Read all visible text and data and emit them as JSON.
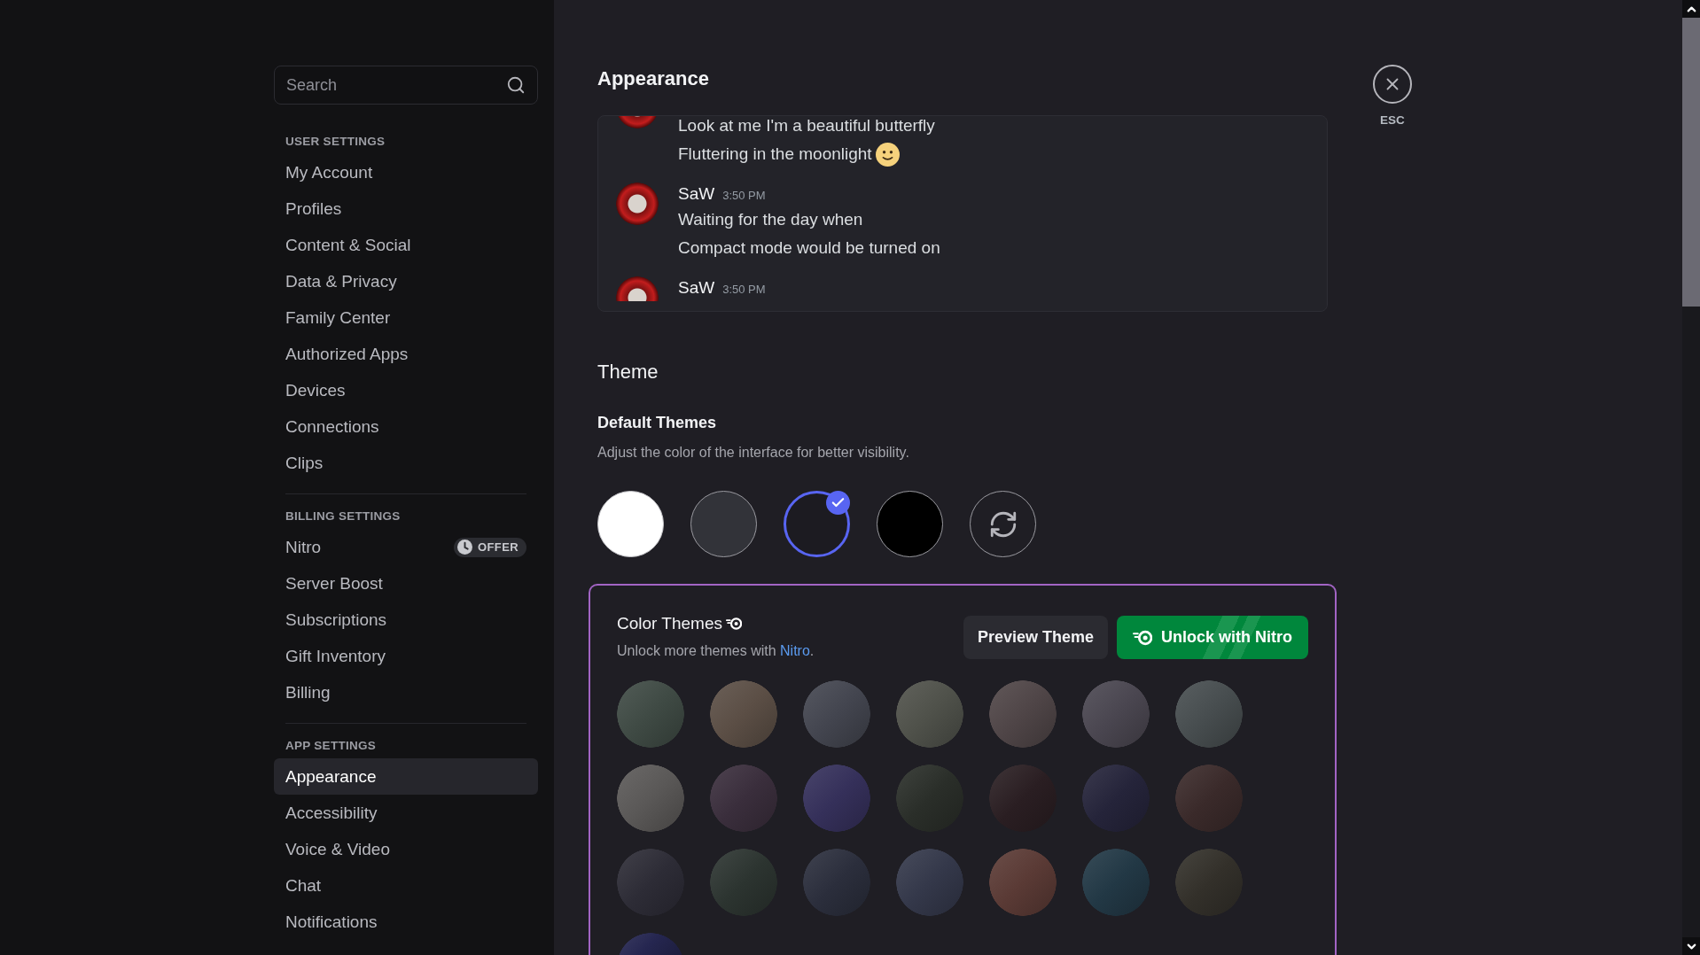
{
  "sidebar": {
    "search": {
      "placeholder": "Search"
    },
    "sections": [
      {
        "title": "USER SETTINGS",
        "items": [
          {
            "label": "My Account",
            "selected": false
          },
          {
            "label": "Profiles",
            "selected": false
          },
          {
            "label": "Content & Social",
            "selected": false
          },
          {
            "label": "Data & Privacy",
            "selected": false
          },
          {
            "label": "Family Center",
            "selected": false
          },
          {
            "label": "Authorized Apps",
            "selected": false
          },
          {
            "label": "Devices",
            "selected": false
          },
          {
            "label": "Connections",
            "selected": false
          },
          {
            "label": "Clips",
            "selected": false
          }
        ]
      },
      {
        "title": "BILLING SETTINGS",
        "items": [
          {
            "label": "Nitro",
            "selected": false,
            "badge": "OFFER"
          },
          {
            "label": "Server Boost",
            "selected": false
          },
          {
            "label": "Subscriptions",
            "selected": false
          },
          {
            "label": "Gift Inventory",
            "selected": false
          },
          {
            "label": "Billing",
            "selected": false
          }
        ]
      },
      {
        "title": "APP SETTINGS",
        "items": [
          {
            "label": "Appearance",
            "selected": true
          },
          {
            "label": "Accessibility",
            "selected": false
          },
          {
            "label": "Voice & Video",
            "selected": false
          },
          {
            "label": "Chat",
            "selected": false
          },
          {
            "label": "Notifications",
            "selected": false
          }
        ]
      }
    ]
  },
  "page": {
    "title": "Appearance",
    "close_label": "ESC"
  },
  "preview": {
    "messages": [
      {
        "lines": [
          {
            "text": "Look at me I'm a beautiful butterfly",
            "emoji": false
          },
          {
            "text": "Fluttering in the moonlight",
            "emoji": true
          }
        ]
      },
      {
        "author": "SaW",
        "time": "3:50 PM",
        "lines": [
          {
            "text": "Waiting for the day when",
            "emoji": false
          },
          {
            "text": "Compact mode would be turned on",
            "emoji": false
          }
        ]
      },
      {
        "author": "SaW",
        "time": "3:50 PM"
      }
    ]
  },
  "theme": {
    "title": "Theme",
    "default_themes": {
      "title": "Default Themes",
      "description": "Adjust the color of the interface for better visibility.",
      "options": [
        {
          "kind": "swatch",
          "color": "#ffffff",
          "selected": false
        },
        {
          "kind": "swatch",
          "color": "#323339",
          "selected": false
        },
        {
          "kind": "swatch",
          "color": "#1c1b21",
          "selected": true
        },
        {
          "kind": "swatch",
          "color": "#000000",
          "selected": false
        },
        {
          "kind": "sync",
          "selected": false
        }
      ]
    },
    "color_themes": {
      "title": "Color Themes",
      "description": {
        "before": "Unlock more themes with ",
        "link": "Nitro",
        "after": "."
      },
      "buttons": [
        {
          "kind": "secondary",
          "label": "Preview Theme"
        },
        {
          "kind": "nitro",
          "label": "Unlock with Nitro"
        }
      ],
      "swatches": [
        {
          "color": "#3f4a44",
          "selected": false
        },
        {
          "color": "#5b4e45",
          "selected": false
        },
        {
          "color": "#43454f",
          "selected": false
        },
        {
          "color": "#4f514a",
          "selected": false
        },
        {
          "color": "#4f4547",
          "selected": false
        },
        {
          "color": "#4a4650",
          "selected": false
        },
        {
          "color": "#474d4f",
          "selected": false
        },
        {
          "color": "#5a5857",
          "selected": false
        },
        {
          "color": "#3a2e3c",
          "selected": false
        },
        {
          "color": "#35305a",
          "selected": false
        },
        {
          "color": "#2a2e29",
          "selected": false
        },
        {
          "color": "#2a1e22",
          "selected": false
        },
        {
          "color": "#25243a",
          "selected": false
        },
        {
          "color": "#3a2a2a",
          "selected": false
        },
        {
          "color": "#2d2c36",
          "selected": false
        },
        {
          "color": "#2c3430",
          "selected": false
        },
        {
          "color": "#2b2e3c",
          "selected": false
        },
        {
          "color": "#34384a",
          "selected": false
        },
        {
          "color": "#5a3a35",
          "selected": false
        },
        {
          "color": "#223845",
          "selected": false
        },
        {
          "color": "#33302a",
          "selected": false
        },
        {
          "color": "#252650",
          "selected": false
        }
      ]
    }
  }
}
